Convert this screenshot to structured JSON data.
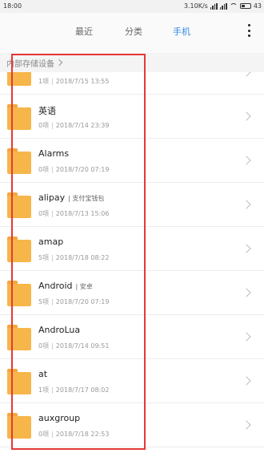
{
  "status_bar": {
    "time": "18:00",
    "net_speed": "3.10K/s",
    "battery": "43"
  },
  "tabs": {
    "recent": "最近",
    "category": "分类",
    "phone": "手机"
  },
  "breadcrumb": {
    "label": "内部存储设备"
  },
  "colors": {
    "accent": "#2f8be6",
    "folder": "#f7b64a",
    "highlight": "#e53935"
  },
  "folders": [
    {
      "name": "",
      "alias": "",
      "count": "1项",
      "date": "2018/7/15 13:55"
    },
    {
      "name": "英语",
      "alias": "",
      "count": "0项",
      "date": "2018/7/14 23:39"
    },
    {
      "name": "Alarms",
      "alias": "",
      "count": "0项",
      "date": "2018/7/20 07:19"
    },
    {
      "name": "alipay",
      "alias": "| 支付宝钱包",
      "count": "0项",
      "date": "2018/7/13 15:06"
    },
    {
      "name": "amap",
      "alias": "",
      "count": "5项",
      "date": "2018/7/18 08:22"
    },
    {
      "name": "Android",
      "alias": "| 安卓",
      "count": "5项",
      "date": "2018/7/20 07:19"
    },
    {
      "name": "AndroLua",
      "alias": "",
      "count": "0项",
      "date": "2018/7/14 09:51"
    },
    {
      "name": "at",
      "alias": "",
      "count": "1项",
      "date": "2018/7/17 08:02"
    },
    {
      "name": "auxgroup",
      "alias": "",
      "count": "0项",
      "date": "2018/7/18 22:53"
    }
  ]
}
